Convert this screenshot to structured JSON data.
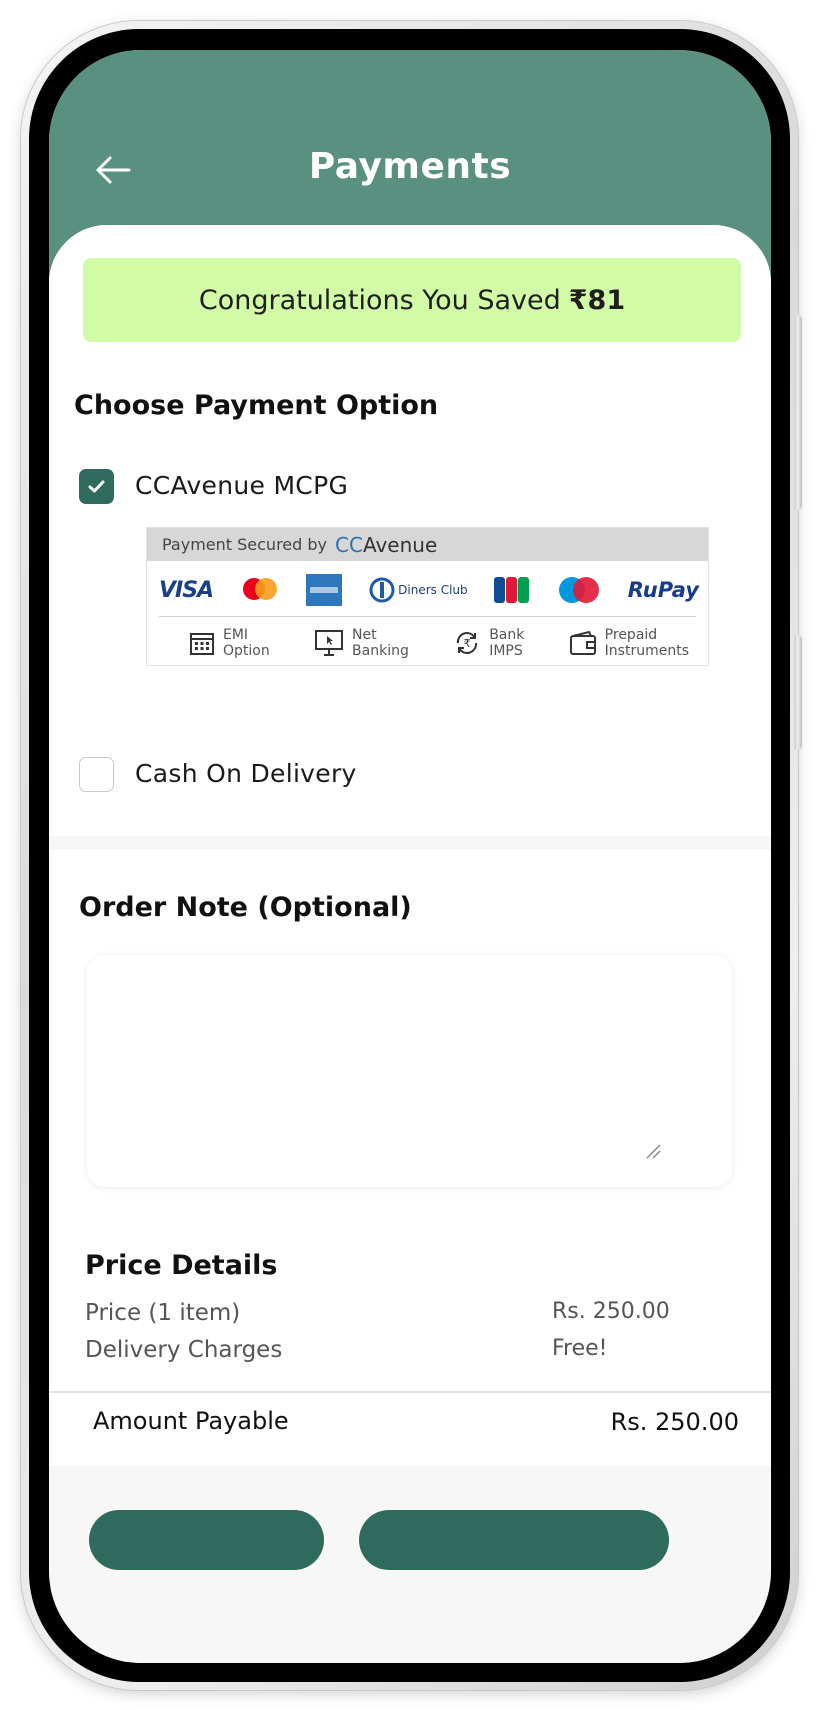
{
  "header": {
    "title": "Payments"
  },
  "banner": {
    "text": "Congratulations You Saved",
    "amount": "₹81"
  },
  "payment": {
    "heading": "Choose Payment Option",
    "options": [
      {
        "label": "CCAvenue MCPG",
        "checked": true
      },
      {
        "label": "Cash On Delivery",
        "checked": false
      }
    ],
    "ccavenue_banner": {
      "secured_by": "Payment Secured by",
      "brand_prefix": "CC",
      "brand_suffix": "Avenue",
      "card_logos": [
        "VISA",
        "Diners Club",
        "RuPay"
      ],
      "modes": [
        {
          "label": "EMI\nOption",
          "icon": "calendar-icon"
        },
        {
          "label": "Net\nBanking",
          "icon": "monitor-icon"
        },
        {
          "label": "Bank\nIMPS",
          "icon": "rupee-refresh-icon"
        },
        {
          "label": "Prepaid\nInstruments",
          "icon": "wallet-icon"
        }
      ]
    }
  },
  "order_note": {
    "heading": "Order Note (Optional)",
    "placeholder": ""
  },
  "price_details": {
    "heading": "Price Details",
    "rows": [
      {
        "label": "Price (1 item)",
        "value": "Rs. 250.00"
      },
      {
        "label": "Delivery Charges",
        "value": "Free!"
      }
    ],
    "amount_payable_label": "Amount Payable",
    "amount_payable_value": "Rs. 250.00"
  },
  "colors": {
    "header": "#5a9080",
    "accent": "#2f6b5c",
    "banner_bg": "#d2fba8"
  }
}
